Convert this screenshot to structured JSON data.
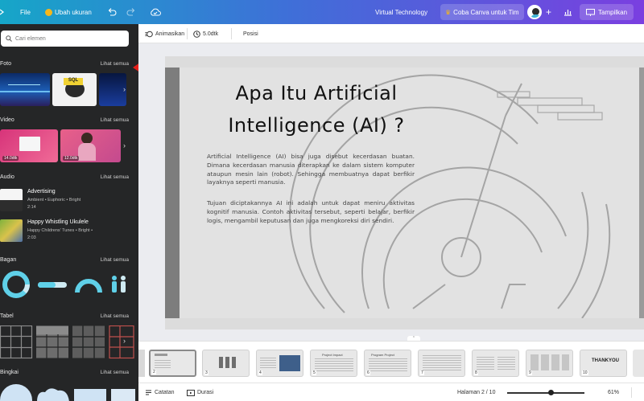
{
  "topbar": {
    "file": "File",
    "resize": "Ubah ukuran",
    "doc_title": "Virtual Technology",
    "try_canva": "Coba Canva untuk Tim",
    "present": "Tampilkan"
  },
  "sidebar": {
    "search_placeholder": "Cari elemen",
    "sections": {
      "foto": "Foto",
      "video": "Video",
      "audio": "Audio",
      "bagan": "Bagan",
      "tabel": "Tabel",
      "bingkai": "Bingkai"
    },
    "see_all": "Lihat semua",
    "videos": [
      "14.0dtk",
      "12.0dtk"
    ],
    "audio": [
      {
        "title": "Advertising",
        "tags": "Ambient • Euphoric • Bright",
        "duration": "2:14"
      },
      {
        "title": "Happy Whistling Ukulele",
        "tags": "Happy Childrens' Tunes • Bright •",
        "duration": "2:03"
      }
    ]
  },
  "toolbar": {
    "animate": "Animasikan",
    "duration": "5.0dtk",
    "position": "Posisi"
  },
  "slide": {
    "title_line1": "Apa Itu Artificial",
    "title_line2": "Intelligence (AI) ?",
    "paragraph1": "Artificial Intelligence (AI) bisa juga disebut kecerdasan buatan. Dimana kecerdasan manusia diterapkan ke dalam sistem komputer ataupun mesin lain (robot). Sehingga membuatnya dapat berfikir layaknya seperti manusia.",
    "paragraph2": "Tujuan diciptakannya AI ini adalah untuk dapat meniru aktivitas kognitif manusia. Contoh aktivitas tersebut, seperti belajar, berfikir logis, mengambil keputusan dan juga mengkoreksi diri sendiri."
  },
  "pages": [
    "2",
    "3",
    "4",
    "5",
    "6",
    "7",
    "8",
    "9",
    "10"
  ],
  "page_thumb_texts": {
    "p5": "Project Impact",
    "p6": "Program Project",
    "p10": "THANKYOU"
  },
  "footer": {
    "notes": "Catatan",
    "duration": "Durasi",
    "page_indicator": "Halaman 2 / 10",
    "zoom": "61%"
  },
  "colors": {
    "sidebar_bg": "#252627",
    "annotation_arrow": "#e8201a",
    "topbar_start": "#16a6c8",
    "topbar_end": "#7a3fe0"
  }
}
